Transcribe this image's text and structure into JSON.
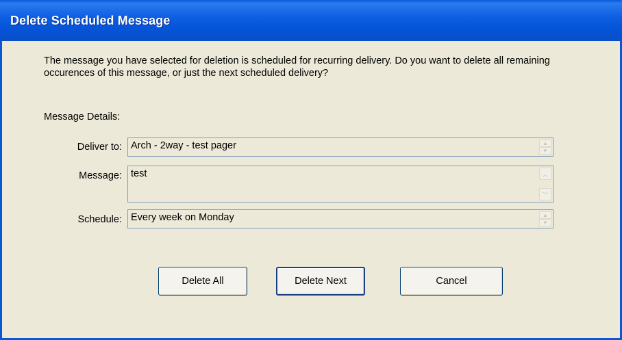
{
  "window": {
    "title": "Delete Scheduled Message"
  },
  "dialog": {
    "prompt": "The message you have selected for deletion is scheduled for recurring delivery.  Do you want to delete all remaining occurences of this message, or just the next scheduled delivery?",
    "details_label": "Message Details:"
  },
  "fields": {
    "deliver_to": {
      "label": "Deliver to:",
      "value": "Arch - 2way - test pager"
    },
    "message": {
      "label": "Message:",
      "value": "test"
    },
    "schedule": {
      "label": "Schedule:",
      "value": "Every week on  Monday"
    }
  },
  "buttons": {
    "delete_all": "Delete All",
    "delete_next": "Delete Next",
    "cancel": "Cancel"
  },
  "icons": {
    "spin_up": "spin-up-icon",
    "spin_down": "spin-down-icon",
    "scroll_up": "scroll-up-icon",
    "scroll_down": "scroll-down-icon"
  },
  "colors": {
    "titlebar": "#0c5ddf",
    "dialog_bg": "#ece9d8",
    "field_border": "#7f9db9",
    "button_border": "#003c74"
  }
}
